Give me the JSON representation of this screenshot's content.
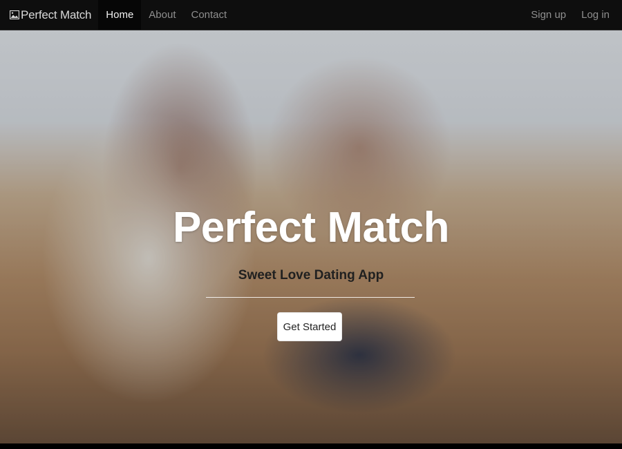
{
  "navbar": {
    "brand_icon": "image-icon",
    "brand_label": "Perfect Match",
    "links": [
      {
        "label": "Home",
        "active": true
      },
      {
        "label": "About",
        "active": false
      },
      {
        "label": "Contact",
        "active": false
      }
    ],
    "right_links": [
      {
        "label": "Sign up"
      },
      {
        "label": "Log in"
      }
    ]
  },
  "hero": {
    "background_image": "couple-laughing-photo",
    "title": "Perfect Match",
    "subtitle": "Sweet Love Dating App",
    "cta_label": "Get Started"
  },
  "colors": {
    "navbar_bg": "#0e0e0e",
    "nav_active_bg": "#060606",
    "nav_text": "#8f8f8f",
    "title_text": "#ffffff",
    "button_bg": "#ffffff"
  }
}
